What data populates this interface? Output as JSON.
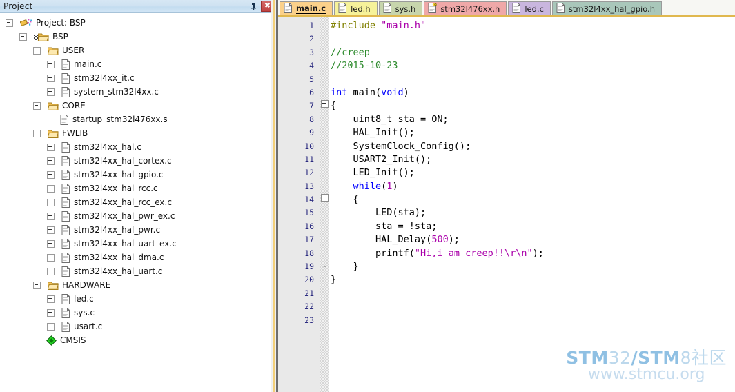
{
  "panel": {
    "title": "Project",
    "pin_icon": "pin-icon",
    "close_label": "✖"
  },
  "tree": {
    "items": [
      {
        "label": "Project: BSP",
        "depth": 0,
        "toggle": "minus",
        "icon": "project-icon"
      },
      {
        "label": "BSP",
        "depth": 1,
        "toggle": "minus",
        "icon": "target-folder-icon"
      },
      {
        "label": "USER",
        "depth": 2,
        "toggle": "minus",
        "icon": "folder-icon"
      },
      {
        "label": "main.c",
        "depth": 3,
        "toggle": "plus",
        "icon": "file-icon"
      },
      {
        "label": "stm32l4xx_it.c",
        "depth": 3,
        "toggle": "plus",
        "icon": "file-icon"
      },
      {
        "label": "system_stm32l4xx.c",
        "depth": 3,
        "toggle": "plus",
        "icon": "file-icon"
      },
      {
        "label": "CORE",
        "depth": 2,
        "toggle": "minus",
        "icon": "folder-icon"
      },
      {
        "label": "startup_stm32l476xx.s",
        "depth": 3,
        "toggle": "none",
        "icon": "file-icon"
      },
      {
        "label": "FWLIB",
        "depth": 2,
        "toggle": "minus",
        "icon": "folder-icon"
      },
      {
        "label": "stm32l4xx_hal.c",
        "depth": 3,
        "toggle": "plus",
        "icon": "file-icon"
      },
      {
        "label": "stm32l4xx_hal_cortex.c",
        "depth": 3,
        "toggle": "plus",
        "icon": "file-icon"
      },
      {
        "label": "stm32l4xx_hal_gpio.c",
        "depth": 3,
        "toggle": "plus",
        "icon": "file-icon"
      },
      {
        "label": "stm32l4xx_hal_rcc.c",
        "depth": 3,
        "toggle": "plus",
        "icon": "file-icon"
      },
      {
        "label": "stm32l4xx_hal_rcc_ex.c",
        "depth": 3,
        "toggle": "plus",
        "icon": "file-icon"
      },
      {
        "label": "stm32l4xx_hal_pwr_ex.c",
        "depth": 3,
        "toggle": "plus",
        "icon": "file-icon"
      },
      {
        "label": "stm32l4xx_hal_pwr.c",
        "depth": 3,
        "toggle": "plus",
        "icon": "file-icon"
      },
      {
        "label": "stm32l4xx_hal_uart_ex.c",
        "depth": 3,
        "toggle": "plus",
        "icon": "file-icon"
      },
      {
        "label": "stm32l4xx_hal_dma.c",
        "depth": 3,
        "toggle": "plus",
        "icon": "file-icon"
      },
      {
        "label": "stm32l4xx_hal_uart.c",
        "depth": 3,
        "toggle": "plus",
        "icon": "file-icon"
      },
      {
        "label": "HARDWARE",
        "depth": 2,
        "toggle": "minus",
        "icon": "folder-icon"
      },
      {
        "label": "led.c",
        "depth": 3,
        "toggle": "plus",
        "icon": "file-icon"
      },
      {
        "label": "sys.c",
        "depth": 3,
        "toggle": "plus",
        "icon": "file-icon"
      },
      {
        "label": "usart.c",
        "depth": 3,
        "toggle": "plus",
        "icon": "file-icon"
      },
      {
        "label": "CMSIS",
        "depth": 2,
        "toggle": "none",
        "icon": "cmsis-icon"
      }
    ]
  },
  "tabs": [
    {
      "label": "main.c",
      "active": true,
      "color": "#fbd18a",
      "icon": "file-icon"
    },
    {
      "label": "led.h",
      "active": false,
      "color": "#f6f29a",
      "icon": "file-icon"
    },
    {
      "label": "sys.h",
      "active": false,
      "color": "#c7d5ac",
      "icon": "file-icon"
    },
    {
      "label": "stm32l476xx.h",
      "active": false,
      "color": "#efa8a8",
      "icon": "readonly-file-icon"
    },
    {
      "label": "led.c",
      "active": false,
      "color": "#c9b6de",
      "icon": "file-icon"
    },
    {
      "label": "stm32l4xx_hal_gpio.h",
      "active": false,
      "color": "#a9c7ba",
      "icon": "file-icon"
    }
  ],
  "editor": {
    "lines": [
      {
        "n": "1",
        "segs": [
          {
            "t": "#include ",
            "c": "pp"
          },
          {
            "t": "\"main.h\"",
            "c": "st"
          }
        ]
      },
      {
        "n": "2",
        "segs": []
      },
      {
        "n": "3",
        "segs": [
          {
            "t": "//creep",
            "c": "cm"
          }
        ]
      },
      {
        "n": "4",
        "segs": [
          {
            "t": "//2015-10-23",
            "c": "cm"
          }
        ]
      },
      {
        "n": "5",
        "segs": []
      },
      {
        "n": "6",
        "segs": [
          {
            "t": "int ",
            "c": "k"
          },
          {
            "t": "main(",
            "c": ""
          },
          {
            "t": "void",
            "c": "k"
          },
          {
            "t": ")",
            "c": ""
          }
        ]
      },
      {
        "n": "7",
        "segs": [
          {
            "t": "{",
            "c": ""
          }
        ]
      },
      {
        "n": "8",
        "segs": [
          {
            "t": "    uint8_t sta = ON;",
            "c": ""
          }
        ]
      },
      {
        "n": "9",
        "segs": [
          {
            "t": "    HAL_Init();",
            "c": ""
          }
        ]
      },
      {
        "n": "10",
        "segs": [
          {
            "t": "    SystemClock_Config();",
            "c": ""
          }
        ]
      },
      {
        "n": "11",
        "segs": [
          {
            "t": "    USART2_Init();",
            "c": ""
          }
        ]
      },
      {
        "n": "12",
        "segs": [
          {
            "t": "    LED_Init();",
            "c": ""
          }
        ]
      },
      {
        "n": "13",
        "segs": [
          {
            "t": "    ",
            "c": ""
          },
          {
            "t": "while",
            "c": "k"
          },
          {
            "t": "(",
            "c": ""
          },
          {
            "t": "1",
            "c": "st"
          },
          {
            "t": ")",
            "c": ""
          }
        ]
      },
      {
        "n": "14",
        "segs": [
          {
            "t": "    {",
            "c": ""
          }
        ]
      },
      {
        "n": "15",
        "segs": [
          {
            "t": "        LED(sta);",
            "c": ""
          }
        ]
      },
      {
        "n": "16",
        "segs": [
          {
            "t": "        sta = !sta;",
            "c": ""
          }
        ]
      },
      {
        "n": "17",
        "segs": [
          {
            "t": "        HAL_Delay(",
            "c": ""
          },
          {
            "t": "500",
            "c": "st"
          },
          {
            "t": ");",
            "c": ""
          }
        ]
      },
      {
        "n": "18",
        "segs": [
          {
            "t": "        printf(",
            "c": ""
          },
          {
            "t": "\"Hi,i am creep!!\\r\\n\"",
            "c": "st"
          },
          {
            "t": ");",
            "c": ""
          }
        ]
      },
      {
        "n": "19",
        "segs": [
          {
            "t": "    }",
            "c": ""
          }
        ]
      },
      {
        "n": "20",
        "segs": [
          {
            "t": "}",
            "c": ""
          }
        ]
      },
      {
        "n": "21",
        "segs": []
      },
      {
        "n": "22",
        "segs": []
      },
      {
        "n": "23",
        "segs": []
      }
    ]
  },
  "watermark": {
    "line1_parts": [
      {
        "t": "STM",
        "bold": true
      },
      {
        "t": "32",
        "bold": false
      },
      {
        "t": "/STM",
        "bold": true
      },
      {
        "t": "8社区",
        "bold": false
      }
    ],
    "line2": "www.stmcu.org",
    "color_bold": "#8fc0e3",
    "color_light": "#bcd8ec"
  }
}
